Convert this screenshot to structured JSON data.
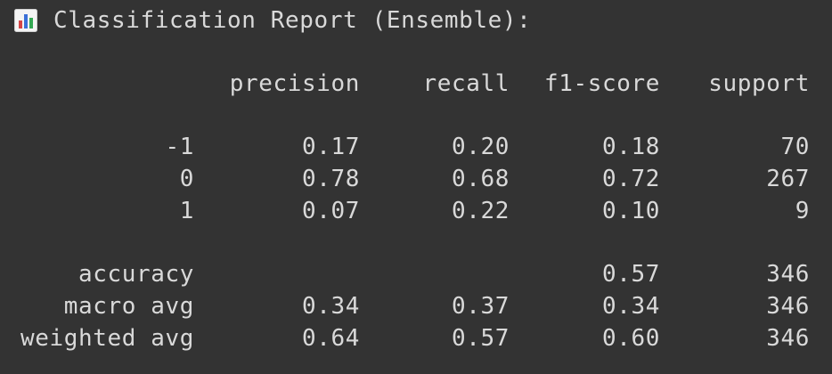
{
  "title": {
    "text": "Classification Report (Ensemble):",
    "icon": "bar-chart-icon"
  },
  "table": {
    "columns": [
      "precision",
      "recall",
      "f1-score",
      "support"
    ],
    "class_rows": [
      {
        "label": "-1",
        "precision": "0.17",
        "recall": "0.20",
        "f1": "0.18",
        "support": "70"
      },
      {
        "label": "0",
        "precision": "0.78",
        "recall": "0.68",
        "f1": "0.72",
        "support": "267"
      },
      {
        "label": "1",
        "precision": "0.07",
        "recall": "0.22",
        "f1": "0.10",
        "support": "9"
      }
    ],
    "summary_rows": [
      {
        "label": "accuracy",
        "precision": "",
        "recall": "",
        "f1": "0.57",
        "support": "346"
      },
      {
        "label": "macro avg",
        "precision": "0.34",
        "recall": "0.37",
        "f1": "0.34",
        "support": "346"
      },
      {
        "label": "weighted avg",
        "precision": "0.64",
        "recall": "0.57",
        "f1": "0.60",
        "support": "346"
      }
    ]
  },
  "colors": {
    "background": "#333333",
    "text": "#d9d9d9"
  }
}
